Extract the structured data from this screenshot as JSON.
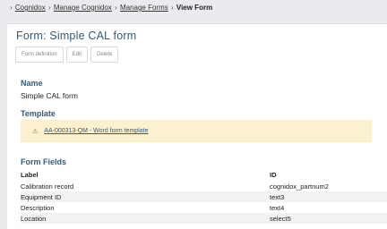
{
  "breadcrumb": {
    "separator": "›",
    "items": [
      "Cognidox",
      "Manage Cognidox",
      "Manage Forms"
    ],
    "current": "View Form"
  },
  "page": {
    "title": "Form: Simple CAL form",
    "buttons": {
      "form_definition": "Form definition",
      "edit": "Edit",
      "delete": "Delete"
    }
  },
  "name_section": {
    "heading": "Name",
    "value": "Simple CAL form"
  },
  "template_section": {
    "heading": "Template",
    "icon": "warning-icon",
    "link_text": "AA-000313-QM - Word form template",
    "alert_color": "#fbf1cf"
  },
  "fields_section": {
    "heading": "Form Fields",
    "columns": [
      "Label",
      "ID"
    ],
    "rows": [
      [
        "Calibration record",
        "cognidox_partnum2"
      ],
      [
        "Equipment ID",
        "text3"
      ],
      [
        "Description",
        "text4"
      ],
      [
        "Location",
        "select5"
      ]
    ]
  },
  "colors": {
    "heading": "#2e5d86",
    "background": "#e9ebee"
  }
}
